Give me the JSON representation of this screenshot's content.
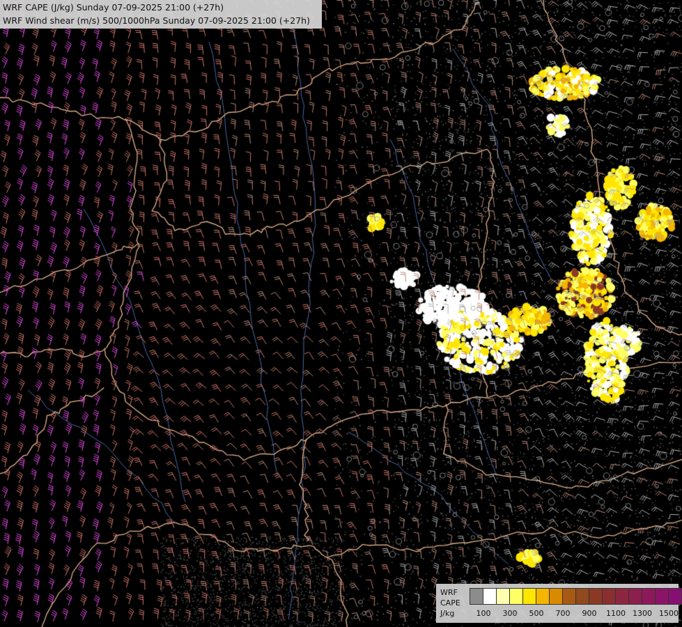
{
  "header": {
    "line1": "WRF CAPE (J/kg) Sunday 07-09-2025 21:00 (+27h)",
    "line2": "WRF Wind shear (m/s) 500/1000hPa Sunday 07-09-2025 21:00 (+27h)"
  },
  "legend": {
    "label1": "WRF",
    "label2": "CAPE",
    "label3": "J/kg",
    "colors": [
      "#8c8c8c",
      "#ffffff",
      "#ffffb0",
      "#ffff66",
      "#ffe600",
      "#f4b400",
      "#d98a00",
      "#a85a14",
      "#8f4a1e",
      "#8a3a24",
      "#8a2e30",
      "#8c2640",
      "#8c1f4c",
      "#8c1a5a",
      "#8a1566",
      "#880f72",
      "#860a80"
    ],
    "ticks": [
      "100",
      "300",
      "500",
      "700",
      "900",
      "1100",
      "1300",
      "1500"
    ]
  },
  "map": {
    "background": "#000000",
    "border_color": "#e6b48c",
    "river_color": "#4a6aa8",
    "barb_colors": [
      "#b0b0b0",
      "#b88878",
      "#c87868",
      "#d87870",
      "#e850e8"
    ],
    "cape_colors": [
      "#ffffff",
      "#ffff66",
      "#ffe600",
      "#f4b400",
      "#8a3a24"
    ]
  }
}
